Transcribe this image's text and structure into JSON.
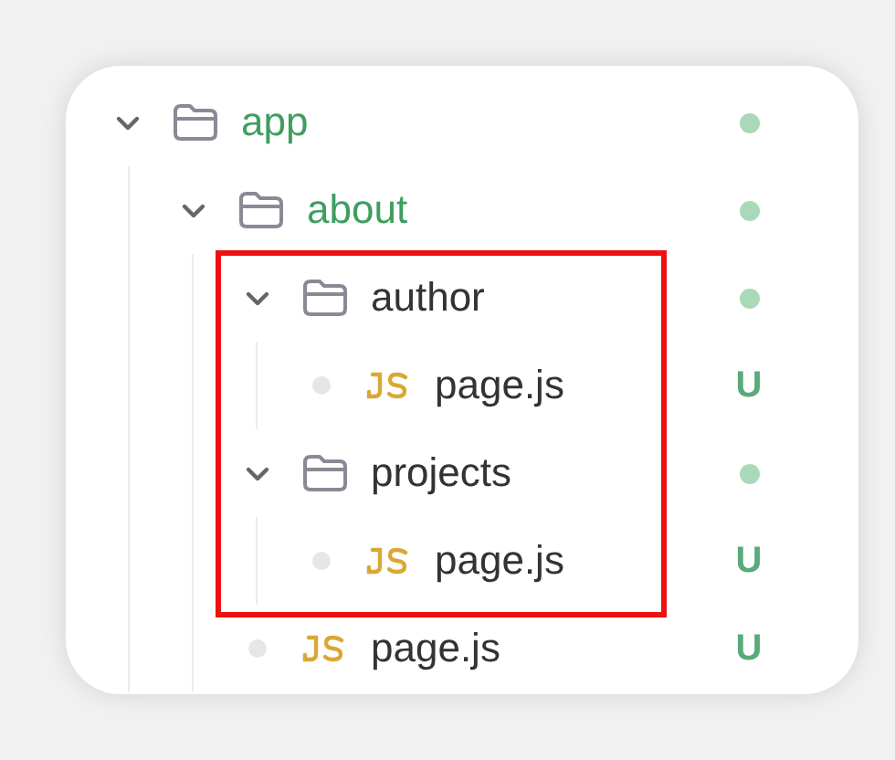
{
  "tree": [
    {
      "kind": "folder",
      "name": "app",
      "color": "#3f9e5f",
      "expanded": true,
      "highlighted": false,
      "status": {
        "kind": "dot"
      },
      "children": [
        {
          "kind": "folder",
          "name": "about",
          "color": "#3f9e5f",
          "expanded": true,
          "highlighted": false,
          "status": {
            "kind": "dot"
          },
          "children": [
            {
              "kind": "folder",
              "name": "author",
              "color": "#333333",
              "expanded": true,
              "highlighted": true,
              "status": {
                "kind": "dot"
              },
              "children": [
                {
                  "kind": "file",
                  "name": "page.js",
                  "color": "#333333",
                  "highlighted": true,
                  "status": {
                    "kind": "letter",
                    "text": "U"
                  }
                }
              ]
            },
            {
              "kind": "folder",
              "name": "projects",
              "color": "#333333",
              "expanded": true,
              "highlighted": true,
              "status": {
                "kind": "dot"
              },
              "children": [
                {
                  "kind": "file",
                  "name": "page.js",
                  "color": "#333333",
                  "highlighted": true,
                  "status": {
                    "kind": "letter",
                    "text": "U"
                  }
                }
              ]
            },
            {
              "kind": "file",
              "name": "page.js",
              "color": "#333333",
              "highlighted": false,
              "status": {
                "kind": "letter",
                "text": "U"
              }
            }
          ]
        }
      ]
    }
  ]
}
